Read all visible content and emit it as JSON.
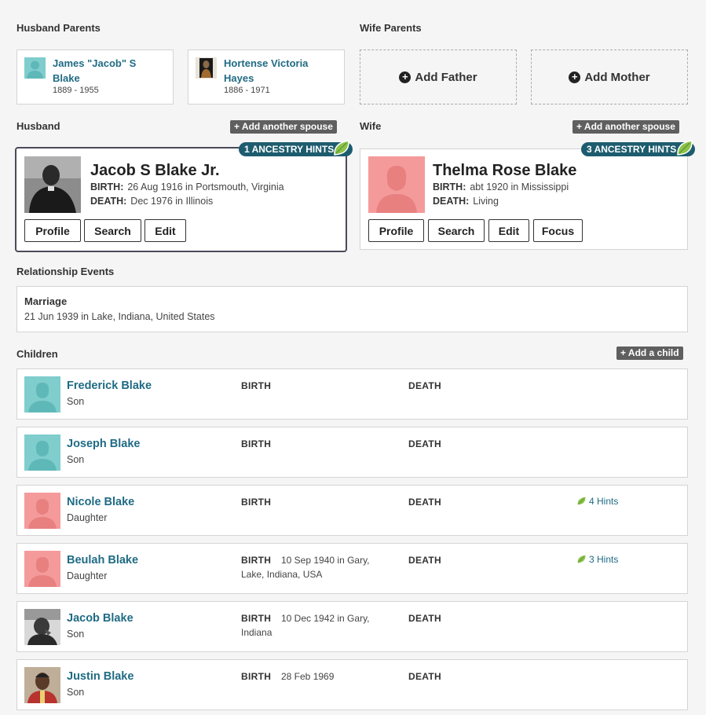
{
  "labels": {
    "husband_parents": "Husband Parents",
    "wife_parents": "Wife Parents",
    "husband": "Husband",
    "wife": "Wife",
    "relationship_events": "Relationship Events",
    "children": "Children"
  },
  "husband_parents": [
    {
      "name": "James \"Jacob\" S Blake",
      "dates": "1889 - 1955",
      "photo": "male-silhouette"
    },
    {
      "name": "Hortense Victoria Hayes",
      "dates": "1886 - 1971",
      "photo": "portrait-photo"
    }
  ],
  "wife_parents": {
    "add_father": "Add Father",
    "add_mother": "Add Mother"
  },
  "add_spouse_label": "+ Add another spouse",
  "husband": {
    "name": "Jacob S Blake Jr.",
    "hints": "1 ANCESTRY HINTS",
    "birth_label": "BIRTH:",
    "birth": "26 Aug 1916 in Portsmouth, Virginia",
    "death_label": "DEATH:",
    "death": "Dec 1976 in Illinois",
    "buttons": {
      "profile": "Profile",
      "search": "Search",
      "edit": "Edit"
    }
  },
  "wife": {
    "name": "Thelma Rose Blake",
    "hints": "3 ANCESTRY HINTS",
    "birth_label": "BIRTH:",
    "birth": "abt 1920 in Mississippi",
    "death_label": "DEATH:",
    "death": "Living",
    "buttons": {
      "profile": "Profile",
      "search": "Search",
      "edit": "Edit",
      "focus": "Focus"
    }
  },
  "marriage": {
    "title": "Marriage",
    "detail": "21 Jun 1939 in Lake, Indiana, United States"
  },
  "add_child_label": "+ Add a child",
  "col_labels": {
    "birth": "BIRTH",
    "death": "DEATH"
  },
  "children": [
    {
      "name": "Frederick Blake",
      "relation": "Son",
      "birth": "",
      "death": "",
      "hints": "",
      "photo": "male-silhouette"
    },
    {
      "name": "Joseph Blake",
      "relation": "Son",
      "birth": "",
      "death": "",
      "hints": "",
      "photo": "male-silhouette"
    },
    {
      "name": "Nicole Blake",
      "relation": "Daughter",
      "birth": "",
      "death": "",
      "hints": "4 Hints",
      "photo": "female-silhouette"
    },
    {
      "name": "Beulah Blake",
      "relation": "Daughter",
      "birth": "10 Sep 1940  in Gary,",
      "birth2": "Lake, Indiana, USA",
      "death": "",
      "hints": "3 Hints",
      "photo": "female-silhouette"
    },
    {
      "name": "Jacob Blake",
      "relation": "Son",
      "birth": "10 Dec 1942  in Gary,",
      "birth2": "Indiana",
      "death": "",
      "hints": "",
      "photo": "portrait-photo"
    },
    {
      "name": "Justin Blake",
      "relation": "Son",
      "birth": "28 Feb 1969",
      "death": "",
      "hints": "",
      "photo": "portrait-photo"
    }
  ],
  "colors": {
    "link": "#1f6b84",
    "male_avatar": "#7fcdcd",
    "female_avatar": "#f59a9a",
    "hints_badge": "#1d5c6e",
    "leaf": "#8bc34a"
  }
}
